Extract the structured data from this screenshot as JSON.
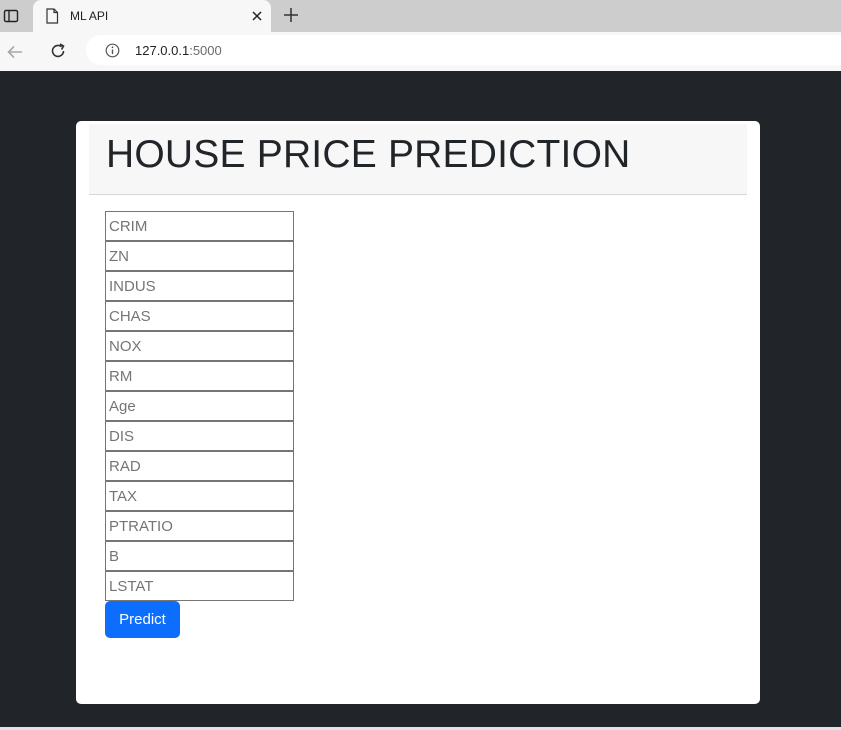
{
  "browser": {
    "tab_title": "ML API",
    "url_host": "127.0.0.1",
    "url_port": ":5000"
  },
  "page": {
    "title": "HOUSE PRICE PREDICTION",
    "fields": [
      {
        "placeholder": "CRIM"
      },
      {
        "placeholder": "ZN"
      },
      {
        "placeholder": "INDUS"
      },
      {
        "placeholder": "CHAS"
      },
      {
        "placeholder": "NOX"
      },
      {
        "placeholder": "RM"
      },
      {
        "placeholder": "Age"
      },
      {
        "placeholder": "DIS"
      },
      {
        "placeholder": "RAD"
      },
      {
        "placeholder": "TAX"
      },
      {
        "placeholder": "PTRATIO"
      },
      {
        "placeholder": "B"
      },
      {
        "placeholder": "LSTAT"
      }
    ],
    "predict_label": "Predict"
  },
  "colors": {
    "page_background": "#212529",
    "button_primary": "#0d6efd",
    "card_background": "#ffffff",
    "header_background": "#f7f7f7"
  }
}
